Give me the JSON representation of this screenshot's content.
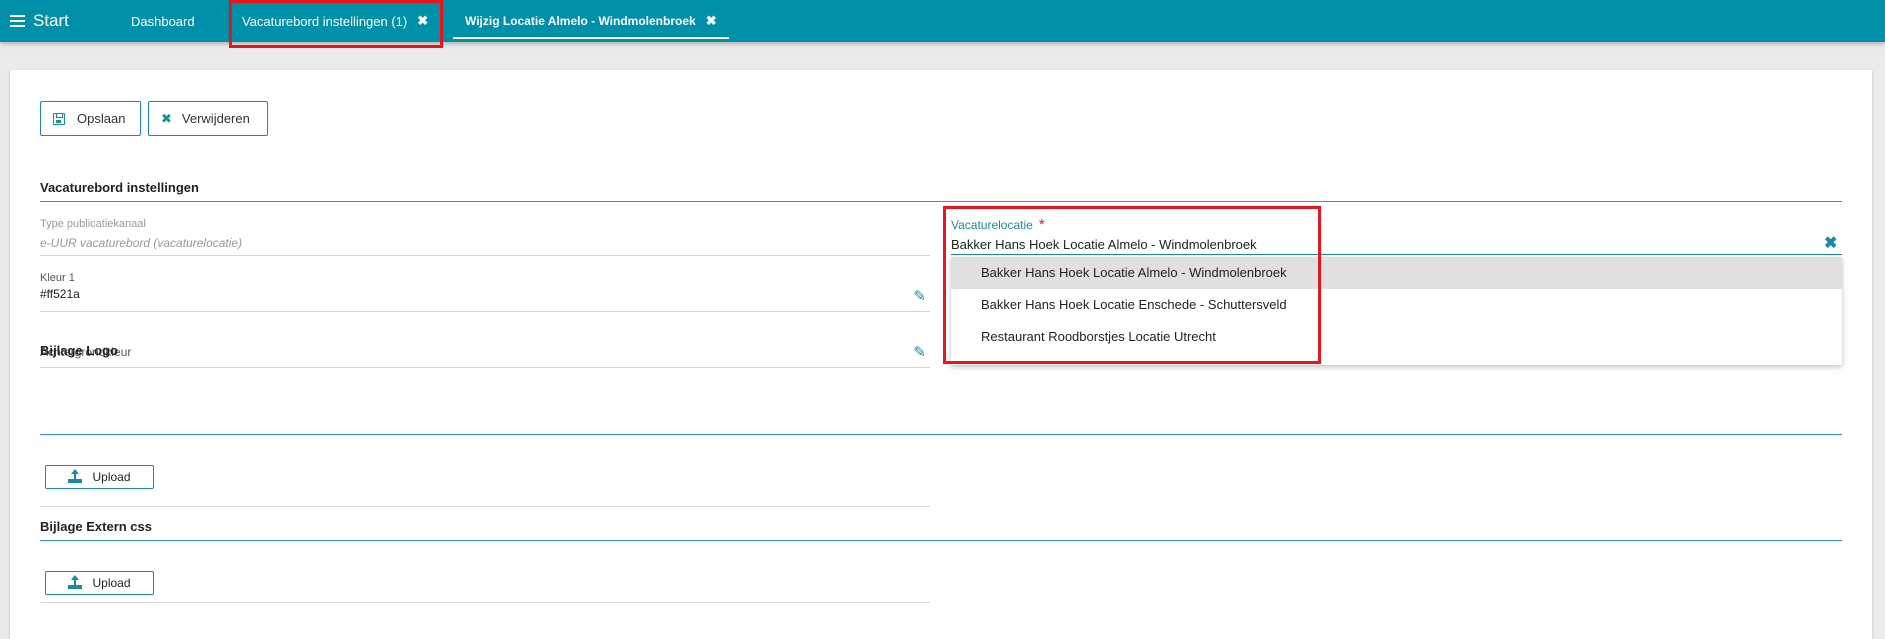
{
  "topbar": {
    "start_label": "Start",
    "tabs": [
      {
        "label": "Dashboard"
      },
      {
        "label": "Vacaturebord instellingen (1)",
        "close": "✖"
      },
      {
        "label": "Wijzig Locatie Almelo - Windmolenbroek",
        "close": "✖"
      }
    ],
    "color": "#0090aa"
  },
  "toolbar": {
    "save_label": "Opslaan",
    "delete_label": "Verwijderen",
    "save_icon": "floppy-icon",
    "delete_icon": "close-icon"
  },
  "section_settings": {
    "title": "Vacaturebord instellingen",
    "type_label": "Type publicatiekanaal",
    "type_value": "e-UUR vacaturebord (vacaturelocatie)",
    "kleur_label": "Kleur 1",
    "kleur_value": "#ff521a",
    "achtergrond_label": "Achtergrondkleur",
    "achtergrond_value": ""
  },
  "vacaturelocatie": {
    "label": "Vacaturelocatie",
    "required": "*",
    "value": "Bakker Hans Hoek Locatie Almelo - Windmolenbroek",
    "clear": "✖",
    "options": [
      "Bakker Hans Hoek Locatie Almelo - Windmolenbroek",
      "Bakker Hans Hoek Locatie Enschede - Schuttersveld",
      "Restaurant Roodborstjes Locatie Utrecht"
    ]
  },
  "section_logo": {
    "title": "Bijlage Logo",
    "upload_label": "Upload"
  },
  "section_css": {
    "title": "Bijlage Extern css",
    "upload_label": "Upload"
  },
  "colors": {
    "accent": "#1a8aa5",
    "highlight": "#e8141e"
  }
}
